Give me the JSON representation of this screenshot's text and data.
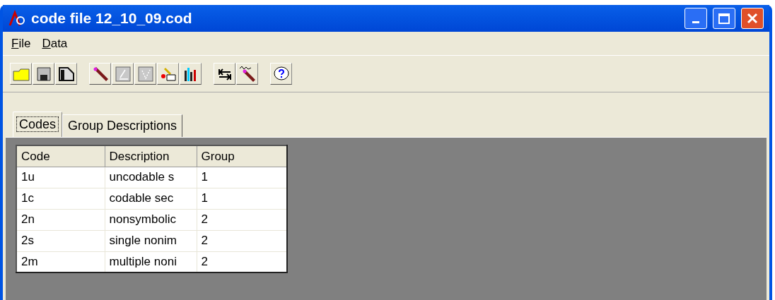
{
  "window": {
    "title": "code file 12_10_09.cod"
  },
  "menu": [
    {
      "label": "File"
    },
    {
      "label": "Data"
    }
  ],
  "tabs": [
    {
      "label": "Codes",
      "selected": true
    },
    {
      "label": "Group Descriptions",
      "selected": false
    }
  ],
  "table": {
    "columns": [
      "Code",
      "Description",
      "Group"
    ],
    "rows": [
      [
        "1u",
        "uncodable s",
        "1"
      ],
      [
        "1c",
        "codable sec",
        "1"
      ],
      [
        "2n",
        "nonsymbolic",
        "2"
      ],
      [
        "2s",
        "single nonim",
        "2"
      ],
      [
        "2m",
        "multiple noni",
        "2"
      ]
    ]
  }
}
